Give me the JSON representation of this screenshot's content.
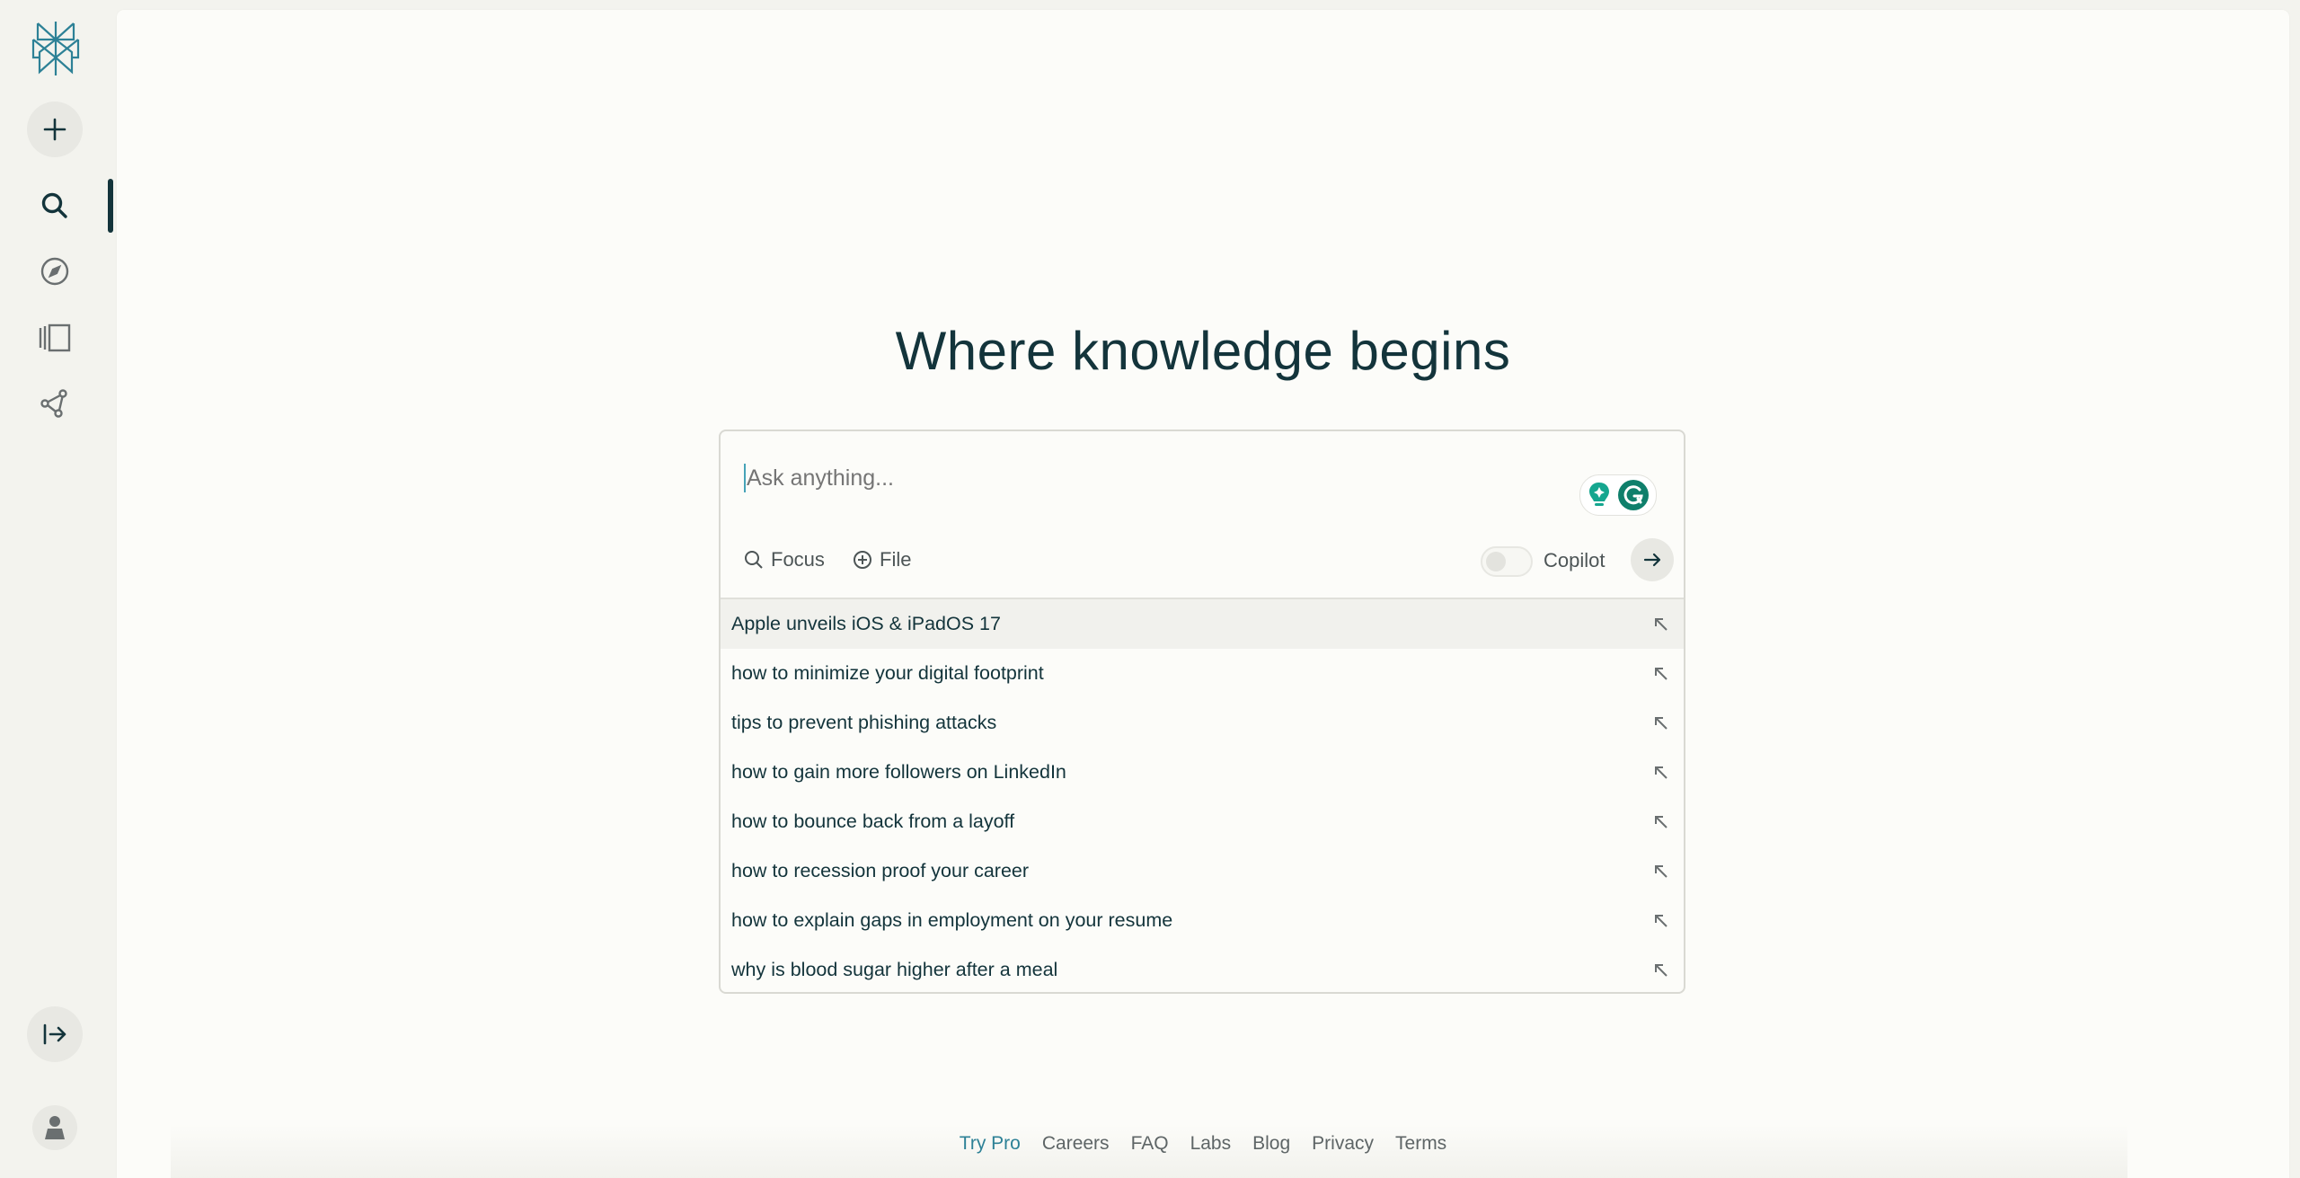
{
  "sidebar": {
    "logo": "perplexity-logo",
    "items": [
      {
        "name": "new-thread",
        "icon": "plus-icon"
      },
      {
        "name": "home",
        "icon": "search-icon",
        "active": true
      },
      {
        "name": "discover",
        "icon": "compass-icon"
      },
      {
        "name": "library",
        "icon": "library-icon"
      },
      {
        "name": "spaces",
        "icon": "share-graph-icon"
      }
    ],
    "bottom": [
      {
        "name": "expand-sidebar",
        "icon": "arrow-right-bar-icon"
      },
      {
        "name": "account",
        "icon": "user-icon"
      }
    ]
  },
  "main": {
    "title": "Where knowledge begins",
    "search": {
      "placeholder": "Ask anything...",
      "value": "",
      "focus_label": "Focus",
      "file_label": "File",
      "copilot_label": "Copilot",
      "copilot_enabled": false
    },
    "suggestions": [
      "Apple unveils iOS & iPadOS 17",
      "how to minimize your digital footprint",
      "tips to prevent phishing attacks",
      "how to gain more followers on LinkedIn",
      "how to bounce back from a layoff",
      "how to recession proof your career",
      "how to explain gaps in employment on your resume",
      "why is blood sugar higher after a meal"
    ]
  },
  "footer": {
    "links": [
      "Try Pro",
      "Careers",
      "FAQ",
      "Labs",
      "Blog",
      "Privacy",
      "Terms"
    ]
  },
  "colors": {
    "accent": "#2d8196",
    "text_primary": "#13343b",
    "background": "#fcfcf9",
    "sidebar_bg": "#f3f3ee"
  }
}
